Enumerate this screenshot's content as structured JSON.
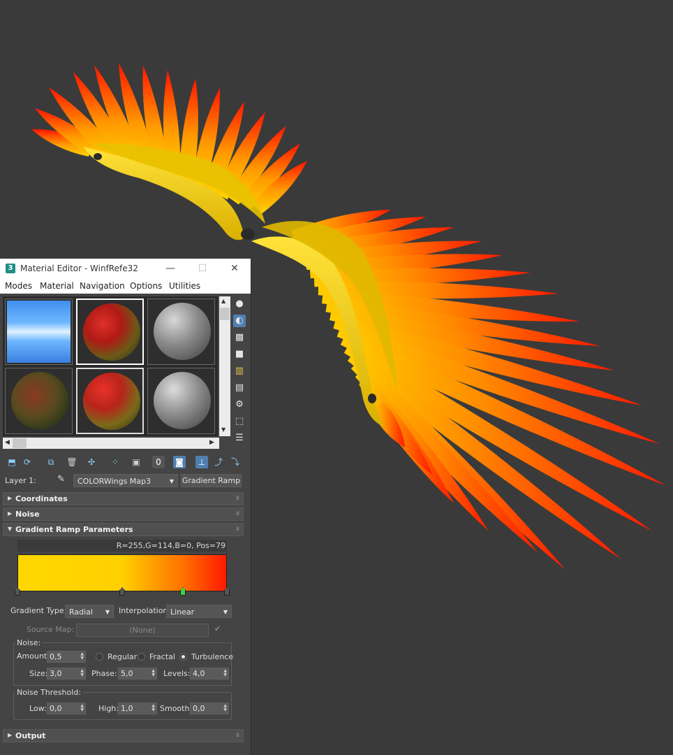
{
  "window": {
    "title": "Material Editor - WinfRefe32",
    "app_icon_text": "3",
    "minimize": "—",
    "maximize": "☐",
    "close": "✕"
  },
  "menu": [
    "Modes",
    "Material",
    "Navigation",
    "Options",
    "Utilities"
  ],
  "layer": {
    "label": "Layer 1:",
    "map_name": "COLORWings Map3",
    "map_type": "Gradient Ramp"
  },
  "rollouts": {
    "coordinates": "Coordinates",
    "noise": "Noise",
    "gradient_ramp": "Gradient Ramp Parameters",
    "output": "Output"
  },
  "gradient": {
    "info": "R=255,G=114,B=0, Pos=79",
    "colors": {
      "start": "#ffd700",
      "mid": "#ffd000",
      "orange": "#ff7200",
      "end": "#ff1a00",
      "active_flag": "#3fd13f"
    },
    "flags": [
      0,
      50,
      79,
      100
    ],
    "type_label": "Gradient Type:",
    "type_value": "Radial",
    "interp_label": "Interpolation:",
    "interp_value": "Linear",
    "source_map_label": "Source Map:",
    "source_map_value": "(None)"
  },
  "noise": {
    "group_title": "Noise:",
    "amount_label": "Amount:",
    "amount": "0,5",
    "regular": "Regular",
    "fractal": "Fractal",
    "turbulence": "Turbulence",
    "selected": "turbulence",
    "size_label": "Size:",
    "size": "3,0",
    "phase_label": "Phase:",
    "phase": "5,0",
    "levels_label": "Levels:",
    "levels": "4,0"
  },
  "threshold": {
    "group_title": "Noise Threshold:",
    "low_label": "Low:",
    "low": "0,0",
    "high_label": "High:",
    "high": "1,0",
    "smooth_label": "Smooth:",
    "smooth": "0,0"
  },
  "colors": {
    "viewport_bg": "#3a3a3a",
    "panel_bg": "#444444",
    "feather_tip": "#ff1a00",
    "feather_base": "#ffd000"
  }
}
